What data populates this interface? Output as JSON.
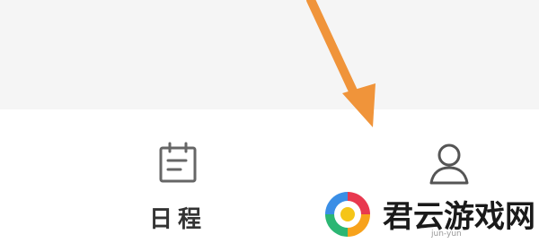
{
  "tab_bar": {
    "items": [
      {
        "label": "日程",
        "icon": "calendar-icon"
      },
      {
        "label": "",
        "icon": "person-icon"
      }
    ]
  },
  "annotation": {
    "icon": "arrow-icon",
    "color": "#f0943a"
  },
  "watermark": {
    "icon": "site-logo",
    "text": "君云游戏网",
    "subtext": "jun-yun"
  }
}
